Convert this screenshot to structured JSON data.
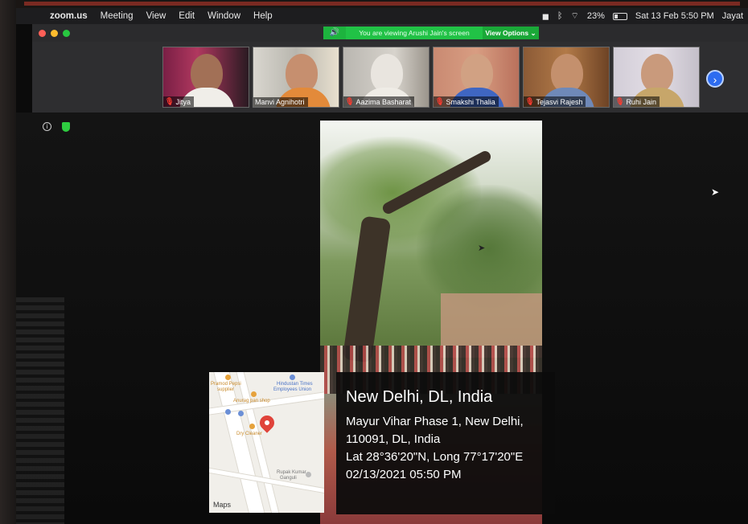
{
  "menubar": {
    "app": "zoom.us",
    "menus": [
      "Meeting",
      "View",
      "Edit",
      "Window",
      "Help"
    ],
    "battery": "23%",
    "clock": "Sat 13 Feb  5:50 PM",
    "user": "Jayat"
  },
  "banner": {
    "viewing": "You are viewing Arushi Jain's screen",
    "view_options": "View Options ⌄"
  },
  "participants": [
    {
      "name": "Jitya"
    },
    {
      "name": "Manvi  Agnihotri"
    },
    {
      "name": "Aazima Basharat"
    },
    {
      "name": "Smakshi Thalia"
    },
    {
      "name": "Tejasvi Rajesh"
    },
    {
      "name": "Ruhi Jain"
    }
  ],
  "map": {
    "labels": {
      "pramod": "Pramod Pepsi",
      "supplier": "supplier",
      "hindustan1": "Hindustan Times",
      "hindustan2": "Employees Union",
      "anurag": "Anurag pan shop",
      "dry": "Dry Cleaner",
      "rupak1": "Rupak Kumar",
      "rupak2": "Ganguli"
    },
    "brand": "Maps"
  },
  "gps": {
    "city": "New Delhi, DL, India",
    "address_line1": "Mayur Vihar Phase 1, New Delhi,",
    "address_line2": "110091, DL, India",
    "coords": "Lat 28°36'20\"N, Long 77°17'20\"E",
    "datetime": "02/13/2021 05:50 PM"
  },
  "colors": {
    "banner_green": "#21c246",
    "next_blue": "#2d6cf0",
    "muted_red": "#ff3b30"
  }
}
